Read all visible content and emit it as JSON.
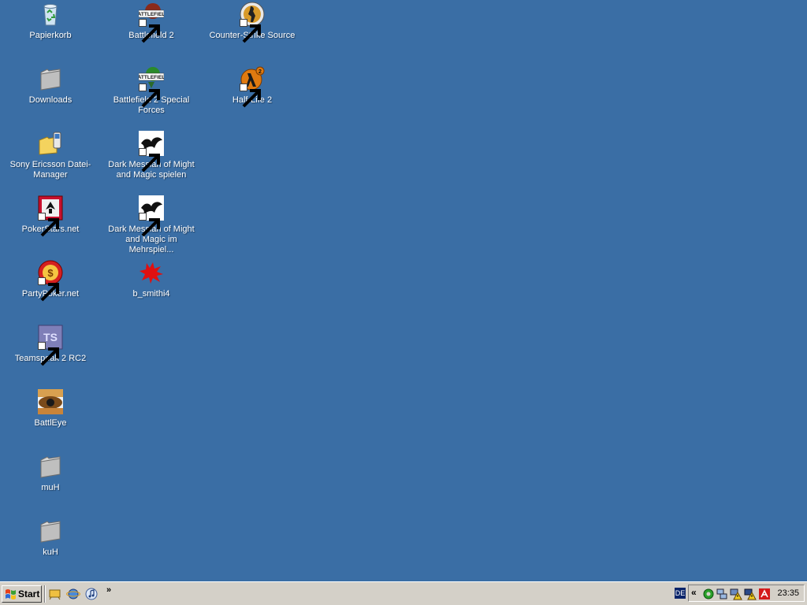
{
  "desktop": {
    "background": "#3a6ea5",
    "icons": [
      {
        "label": "Papierkorb",
        "icon": "recycle-bin-icon"
      },
      {
        "label": "Downloads",
        "icon": "folder-icon"
      },
      {
        "label": "Sony Ericsson Datei-Manager",
        "icon": "sony-ericsson-icon"
      },
      {
        "label": "PokerStars.net",
        "icon": "pokerstars-icon"
      },
      {
        "label": "PartyPoker.net",
        "icon": "partypoker-icon"
      },
      {
        "label": "Teamspeak 2 RC2",
        "icon": "teamspeak-icon"
      },
      {
        "label": "BattlEye",
        "icon": "battleye-icon"
      },
      {
        "label": "muH",
        "icon": "folder-icon"
      },
      {
        "label": "kuH",
        "icon": "folder-icon"
      },
      {
        "label": "Battlefield 2",
        "icon": "battlefield-icon"
      },
      {
        "label": "Battlefield 2 Special Forces",
        "icon": "battlefield-sf-icon"
      },
      {
        "label": "Dark Messiah of Might and Magic spielen",
        "icon": "dark-messiah-icon"
      },
      {
        "label": "Dark Messiah of Might and Magic im Mehrspiel...",
        "icon": "dark-messiah-icon"
      },
      {
        "label": "b_smithi4",
        "icon": "red-splat-icon"
      },
      {
        "label": "Counter-Strike Source",
        "icon": "counter-strike-icon"
      },
      {
        "label": "Half-Life 2",
        "icon": "half-life-icon"
      }
    ]
  },
  "taskbar": {
    "start_label": "Start",
    "chevron": "»",
    "language": "DE",
    "tray_expand": "«",
    "clock": "23:35"
  }
}
